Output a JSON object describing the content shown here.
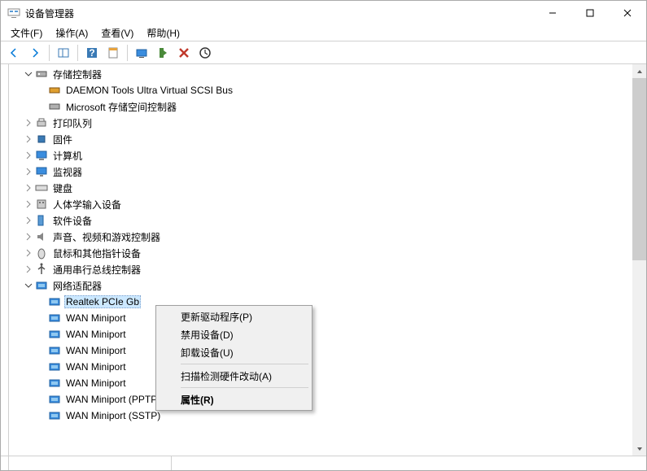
{
  "window": {
    "title": "设备管理器",
    "buttons": {
      "min": "–",
      "max": "☐",
      "close": "✕"
    }
  },
  "menu": {
    "file": "文件(F)",
    "action": "操作(A)",
    "view": "查看(V)",
    "help": "帮助(H)"
  },
  "toolbar": {
    "back": "back",
    "forward": "forward",
    "up": "up",
    "show_hide": "show-hide",
    "help": "help",
    "prop": "properties",
    "monitor": "monitor",
    "scan": "scan",
    "remove": "remove",
    "more": "more"
  },
  "tree": {
    "storage": {
      "label": "存储控制器",
      "children": {
        "daemon": "DAEMON Tools Ultra Virtual SCSI Bus",
        "ms": "Microsoft 存储空间控制器"
      }
    },
    "print": "打印队列",
    "firmware": "固件",
    "computer": "计算机",
    "monitor": "监视器",
    "keyboard": "键盘",
    "hid": "人体学输入设备",
    "software": "软件设备",
    "audio": "声音、视频和游戏控制器",
    "mouse": "鼠标和其他指针设备",
    "usb": "通用串行总线控制器",
    "network": {
      "label": "网络适配器",
      "children": {
        "realtek": "Realtek PCIe Gb",
        "wan1": "WAN Miniport",
        "wan2": "WAN Miniport",
        "wan3": "WAN Miniport",
        "wan4": "WAN Miniport",
        "wan5": "WAN Miniport",
        "wan_pptp": "WAN Miniport (PPTP)",
        "wan_sstp": "WAN Miniport (SSTP)"
      }
    }
  },
  "context_menu": {
    "update": "更新驱动程序(P)",
    "disable": "禁用设备(D)",
    "uninstall": "卸载设备(U)",
    "scan": "扫描检测硬件改动(A)",
    "properties": "属性(R)"
  }
}
